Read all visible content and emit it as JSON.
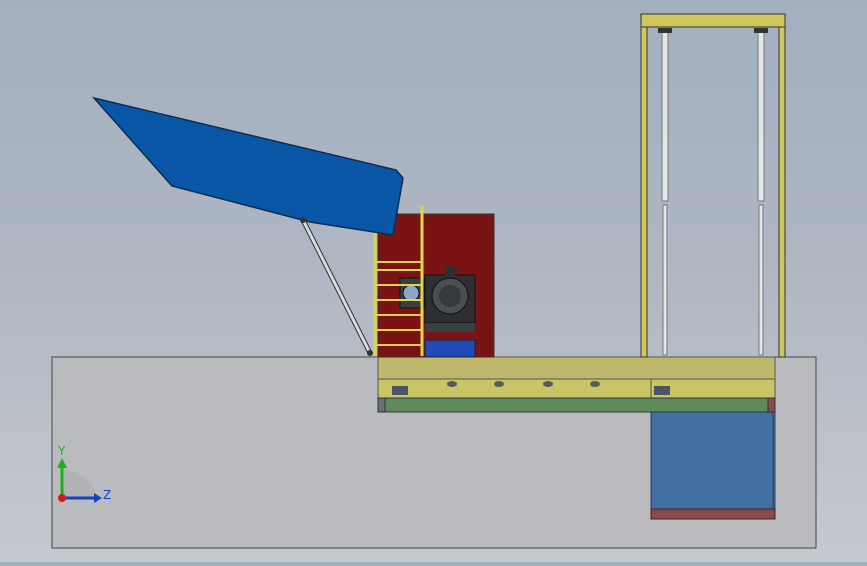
{
  "triad": {
    "y_label": "Y",
    "z_label": "Z"
  },
  "colors": {
    "background_top": "#a3afbf",
    "background_bottom": "#c6c9cf",
    "ground": "#b9bbbe",
    "hopper": "#0a56a6",
    "cabinet": "#7a1414",
    "frame_yellow": "#c8c25e",
    "rail_green": "#5e8a5a",
    "pit_blue": "#3f6fa3",
    "pit_bottom": "#8b4a4a",
    "motor": "#2d2f33",
    "axis_y": "#17b31b",
    "axis_z": "#1540c8",
    "axis_x": "#d41a1a"
  }
}
